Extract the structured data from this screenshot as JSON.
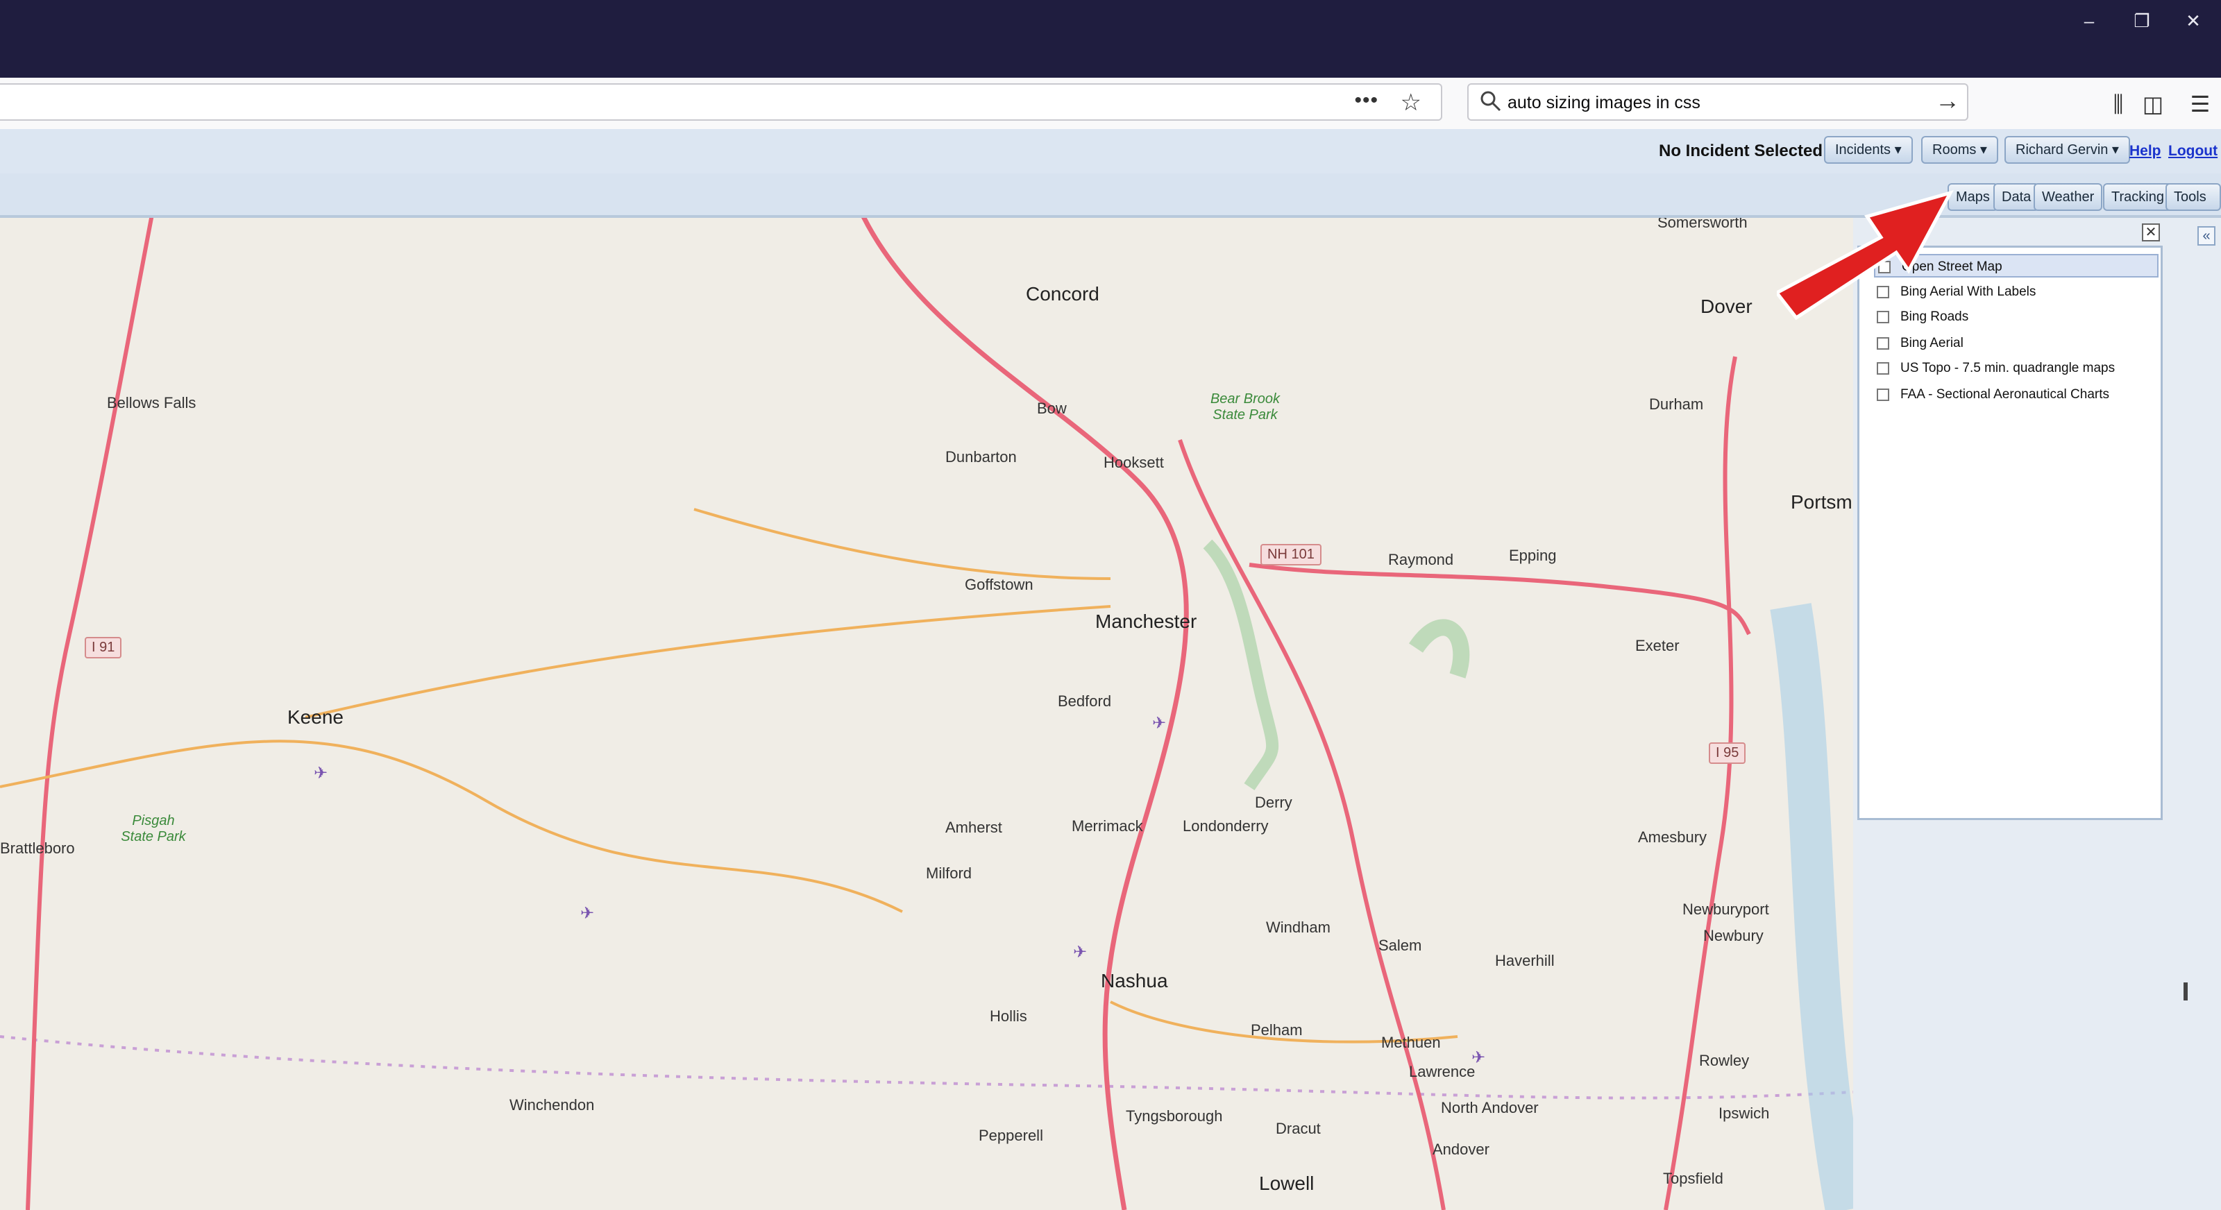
{
  "browser": {
    "window_controls": [
      "–",
      "❐",
      "✕"
    ],
    "search": {
      "value": "auto sizing images in css"
    }
  },
  "app": {
    "status": "No Incident Selected",
    "menus": [
      "Incidents ▾",
      "Rooms ▾",
      "Richard Gervin ▾"
    ],
    "links": [
      "Help",
      "Logout"
    ],
    "tabs": [
      "Maps",
      "Data",
      "Weather",
      "Tracking",
      "Tools ▾"
    ]
  },
  "layers_panel": {
    "close_label": "✕",
    "collapse_label": "«",
    "items": [
      {
        "label": "Open Street Map",
        "checked": true
      },
      {
        "label": "Bing Aerial With Labels",
        "checked": false
      },
      {
        "label": "Bing Roads",
        "checked": false
      },
      {
        "label": "Bing Aerial",
        "checked": false
      },
      {
        "label": "US Topo - 7.5 min. quadrangle maps",
        "checked": false
      },
      {
        "label": "FAA - Sectional Aeronautical Charts",
        "checked": false
      }
    ]
  },
  "map": {
    "cities": [
      "Concord",
      "Manchester",
      "Keene",
      "Nashua",
      "Lowell",
      "Dover",
      "Portsm"
    ],
    "towns": [
      "Bellows Falls",
      "Bow",
      "Dunbarton",
      "Hooksett",
      "Goffstown",
      "Bedford",
      "Amherst",
      "Milford",
      "Merrimack",
      "Londonderry",
      "Derry",
      "Hollis",
      "Windham",
      "Salem",
      "Pelham",
      "Methuen",
      "Lawrence",
      "North Andover",
      "Andover",
      "Dracut",
      "Tyngsborough",
      "Pepperell",
      "Winchendon",
      "Brattleboro",
      "Raymond",
      "Epping",
      "Exeter",
      "Durham",
      "Amesbury",
      "Newburyport",
      "Newbury",
      "Haverhill",
      "Rowley",
      "Ipswich",
      "Topsfield",
      "Somersworth"
    ],
    "parks": [
      "Bear Brook State Park",
      "Pisgah State Park"
    ],
    "shields": [
      "NH 101",
      "I 91",
      "I 95"
    ]
  }
}
